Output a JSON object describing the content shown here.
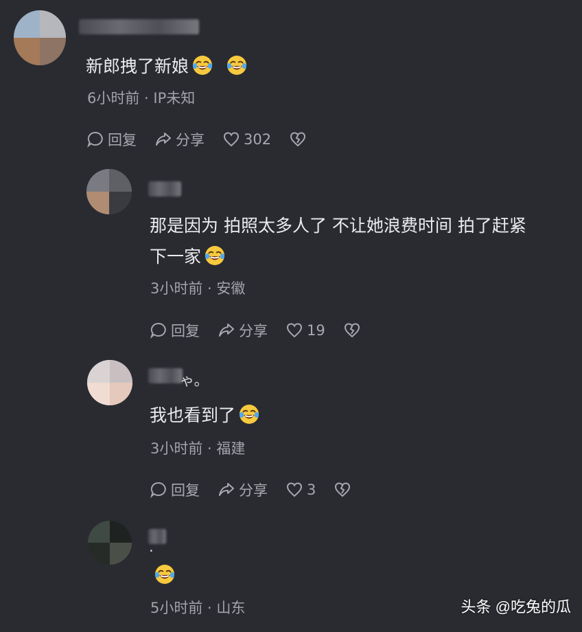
{
  "comments": [
    {
      "text": "新郎拽了新娘",
      "meta": "6小时前 · IP未知",
      "reply_label": "回复",
      "share_label": "分享",
      "likes": "302"
    },
    {
      "text_line1": "那是因为 拍照太多人了 不让她浪费时间 拍了赶紧",
      "text_line2": "下一家",
      "meta": "3小时前 · 安徽",
      "reply_label": "回复",
      "share_label": "分享",
      "likes": "19"
    },
    {
      "username_fragment": "ゃ。",
      "text": "我也看到了",
      "meta": "3小时前 · 福建",
      "reply_label": "回复",
      "share_label": "分享",
      "likes": "3"
    },
    {
      "username_fragment": ".",
      "meta": "5小时前 · 山东"
    }
  ],
  "watermark": "头条 @吃兔的瓜",
  "colors": {
    "background": "#2a2b31",
    "text": "#ececf0",
    "meta": "#a3a4ab",
    "emoji": "#f7c93e"
  },
  "icons": {
    "reply": "speech-bubble-icon",
    "share": "share-arrow-icon",
    "like": "heart-icon",
    "dislike": "broken-heart-icon",
    "emoji": "laughing-crying-emoji-icon"
  }
}
